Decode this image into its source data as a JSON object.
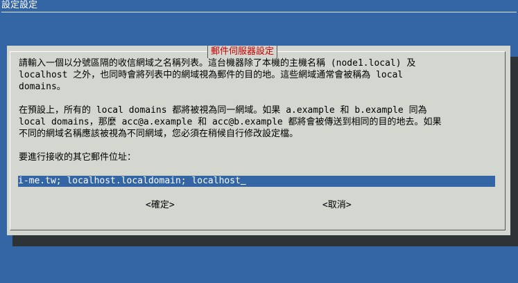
{
  "backtitle": "設定設定",
  "dialog": {
    "title": "郵件伺服器設定",
    "paragraph1": [
      "請輸入一個以分號區隔的收信網域之名稱列表。這台機器除了本機的主機名稱 (node1.local) 及",
      "localhost 之外，也同時會將列表中的網域視為郵件的目的地。這些網域通常會被稱為 local",
      "domains。"
    ],
    "paragraph2": [
      "在預設上，所有的 local domains 都將被視為同一網域。如果 a.example 和 b.example 同為",
      "local domains，那麼 acc@a.example 和 acc@b.example 都將會被傳送到相同的目的地去。如果",
      "不同的網域名稱應該被視為不同網域，您必須在稍候自行修改設定檔。"
    ],
    "prompt": "要進行接收的其它郵件位址：",
    "input_value": "i-me.tw; localhost.localdomain; localhost",
    "ok_label": "<確定>",
    "cancel_label": "<取消>"
  },
  "colors": {
    "background": "#3465a4",
    "dialog": "#d3d7cf",
    "title": "#cc0000",
    "shadow": "#2e3436",
    "input_bg": "#3465a4",
    "input_text": "#ffffff"
  }
}
